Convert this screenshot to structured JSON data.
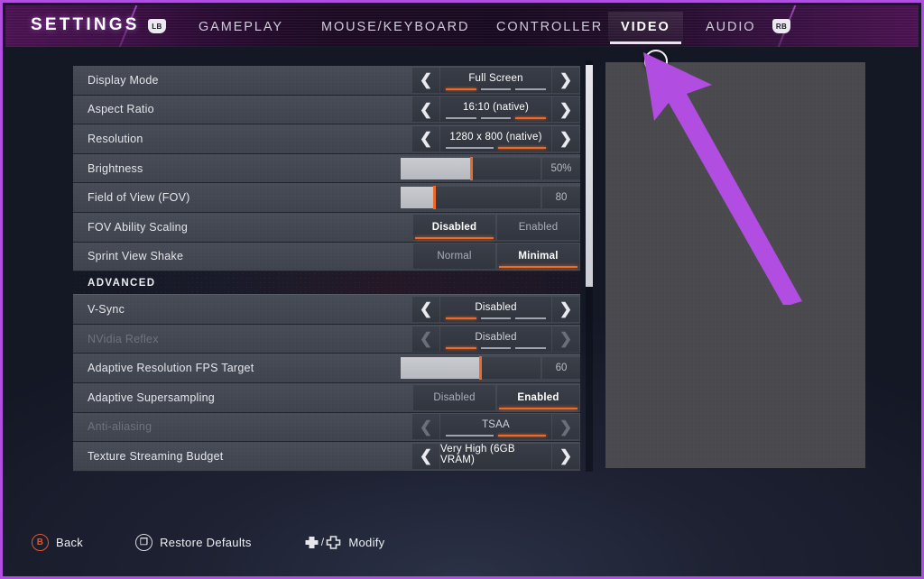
{
  "header": {
    "title": "SETTINGS",
    "bumper_left": "LB",
    "bumper_right": "RB",
    "tabs": [
      {
        "label": "GAMEPLAY",
        "active": false
      },
      {
        "label": "MOUSE/KEYBOARD",
        "active": false
      },
      {
        "label": "CONTROLLER",
        "active": false
      },
      {
        "label": "VIDEO",
        "active": true
      },
      {
        "label": "AUDIO",
        "active": false
      }
    ]
  },
  "settings": {
    "rows": [
      {
        "type": "stepper",
        "label": "Display Mode",
        "value": "Full Screen",
        "segments": 3,
        "selected_segment": 0,
        "disabled": false
      },
      {
        "type": "stepper",
        "label": "Aspect Ratio",
        "value": "16:10 (native)",
        "segments": 3,
        "selected_segment": 2,
        "disabled": false
      },
      {
        "type": "stepper",
        "label": "Resolution",
        "value": "1280 x 800 (native)",
        "segments": 2,
        "selected_segment": 1,
        "disabled": false
      },
      {
        "type": "slider",
        "label": "Brightness",
        "value": "50%",
        "percent": 50,
        "disabled": false
      },
      {
        "type": "slider",
        "label": "Field of View (FOV)",
        "value": "80",
        "percent": 24,
        "disabled": false
      },
      {
        "type": "toggle",
        "label": "FOV Ability Scaling",
        "options": [
          "Disabled",
          "Enabled"
        ],
        "selected": 0,
        "disabled": false
      },
      {
        "type": "toggle",
        "label": "Sprint View Shake",
        "options": [
          "Normal",
          "Minimal"
        ],
        "selected": 1,
        "disabled": false
      },
      {
        "type": "section",
        "label": "ADVANCED"
      },
      {
        "type": "stepper",
        "label": "V-Sync",
        "value": "Disabled",
        "segments": 3,
        "selected_segment": 0,
        "disabled": false
      },
      {
        "type": "stepper",
        "label": "NVidia Reflex",
        "value": "Disabled",
        "segments": 3,
        "selected_segment": 0,
        "disabled": true
      },
      {
        "type": "slider",
        "label": "Adaptive Resolution FPS Target",
        "value": "60",
        "percent": 57,
        "disabled": false
      },
      {
        "type": "toggle",
        "label": "Adaptive Supersampling",
        "options": [
          "Disabled",
          "Enabled"
        ],
        "selected": 1,
        "disabled": false
      },
      {
        "type": "stepper",
        "label": "Anti-aliasing",
        "value": "TSAA",
        "segments": 2,
        "selected_segment": 1,
        "disabled": true
      },
      {
        "type": "stepper",
        "label": "Texture Streaming Budget",
        "value": "Very High (6GB VRAM)",
        "segments": 0,
        "selected_segment": -1,
        "disabled": false
      }
    ]
  },
  "scrollbar": {
    "thumb_top_percent": 1,
    "thumb_height_percent": 54
  },
  "footer": {
    "buttons": [
      {
        "glyph": "B",
        "label": "Back",
        "style": "b"
      },
      {
        "glyph": "❐",
        "label": "Restore Defaults",
        "style": "normal"
      },
      {
        "glyph": "dpad",
        "label": "Modify",
        "style": "dpad"
      }
    ]
  },
  "annotation": {
    "color": "#b14de0",
    "shape": "arrow-pointing-up-left"
  },
  "colors": {
    "accent_orange": "#ef6a28",
    "frame_purple": "#b14de0",
    "row_bg": "#474c57",
    "panel_bg": "#4a4a4e"
  }
}
